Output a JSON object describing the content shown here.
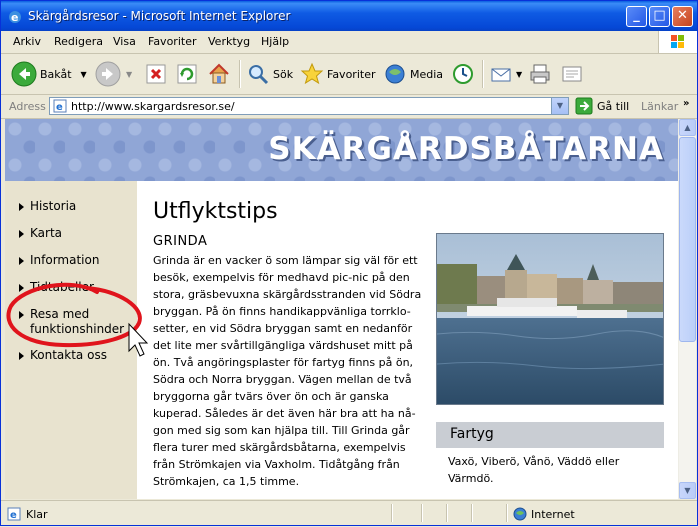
{
  "window": {
    "title": "Skärgårdsresor - Microsoft Internet Explorer",
    "controls": {
      "minimize": "_",
      "maximize": "□",
      "close": "✕"
    }
  },
  "menubar": [
    "Arkiv",
    "Redigera",
    "Visa",
    "Favoriter",
    "Verktyg",
    "Hjälp"
  ],
  "toolbar": {
    "back": "Bakåt",
    "search": "Sök",
    "favorites": "Favoriter",
    "media": "Media"
  },
  "address": {
    "label": "Adress",
    "url": "http://www.skargardsresor.se/",
    "go": "Gå till",
    "links": "Länkar"
  },
  "page": {
    "site_title": "SKÄRGÅRDSBÅTARNA",
    "nav": [
      "Historia",
      "Karta",
      "Information",
      "Tidtabeller",
      "Resa med funktionshinder",
      "Kontakta oss"
    ],
    "heading": "Utflyktstips",
    "subheading": "GRINDA",
    "body": "Grinda är en vacker ö som lämpar sig väl för ett besök, exempelvis för medhavd pic-nic på den stora, gräsbevuxna skärgårdsstranden vid Södra bryggan. På ön finns handikappvänliga torrklo-setter, en vid Södra bryggan samt en nedanför det lite mer svårtillgängliga värdshuset mitt på ön. Två angöringsplaster för fartyg finns på ön, Södra och Norra bryggan. Vägen mellan de två bryggorna går tvärs över ön och är ganska kuperad. Således är det även här bra att ha nå-gon med sig som kan hjälpa till. Till Grinda går flera turer med skärgårdsbåtarna, exempelvis från Strömkajen via Vaxholm. Tidåtgång från Strömkajen, ca 1,5 timme.",
    "sidebox_title": "Fartyg",
    "sidebox_text": "Vaxö, Viberö, Vånö, Väddö eller Värmdö."
  },
  "status": {
    "text": "Klar",
    "zone": "Internet"
  }
}
